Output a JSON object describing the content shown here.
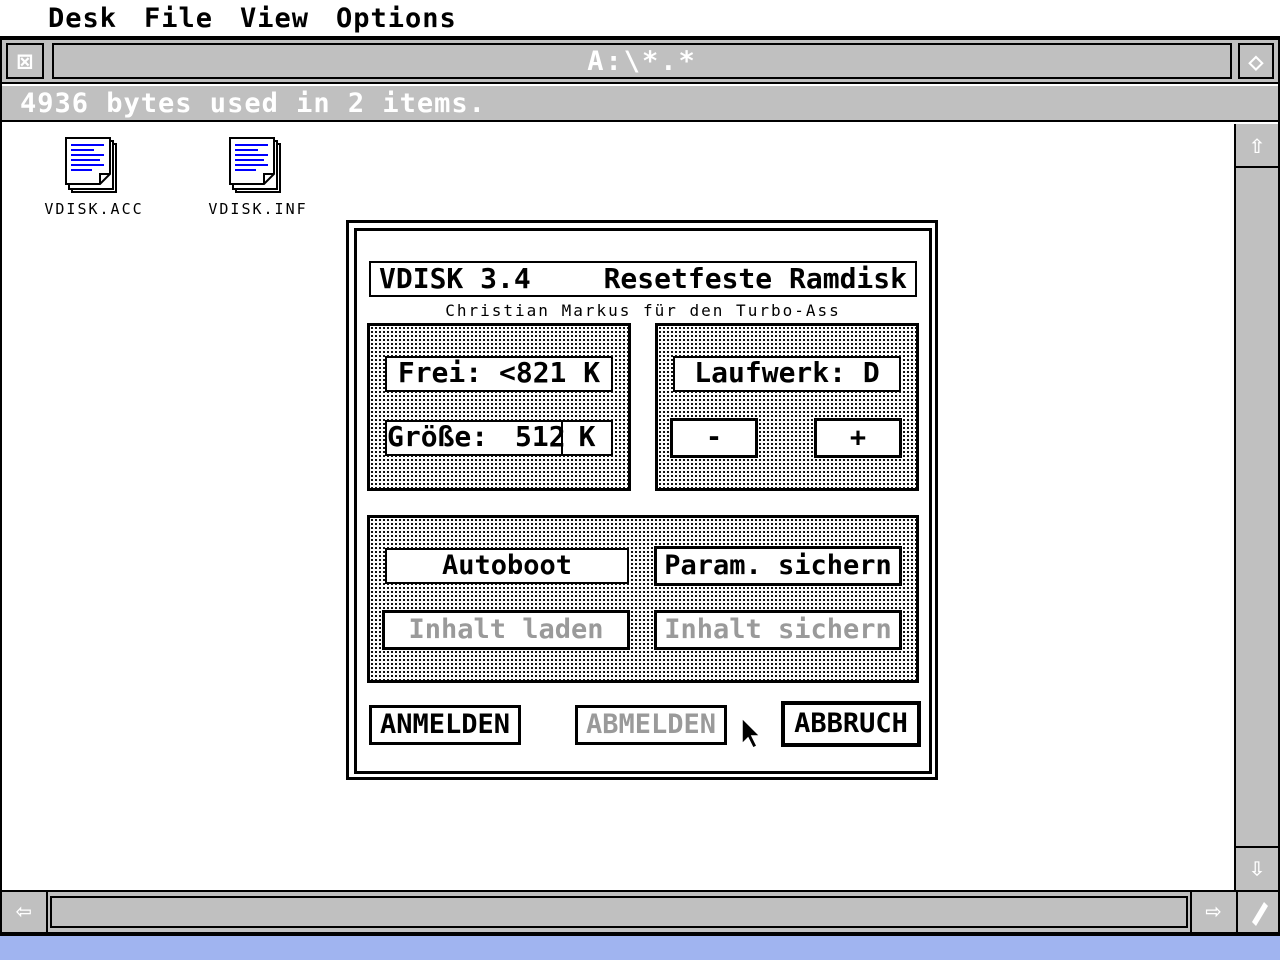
{
  "menubar": {
    "items": [
      "Desk",
      "File",
      "View",
      "Options"
    ]
  },
  "window": {
    "title": "A:\\*.*",
    "info": "4936 bytes used in 2 items.",
    "close_glyph": "⊠",
    "full_glyph": "◇",
    "up_glyph": "⇧",
    "down_glyph": "⇩",
    "left_glyph": "⇦",
    "right_glyph": "⇨",
    "files": [
      {
        "name": "VDISK.ACC",
        "icon": "document-icon"
      },
      {
        "name": "VDISK.INF",
        "icon": "document-icon"
      }
    ]
  },
  "dialog": {
    "title_left": "VDISK 3.4",
    "title_right": "Resetfeste Ramdisk",
    "subtitle": "Christian Markus für den Turbo-Ass",
    "frei": "Frei: <821 K",
    "groesse_label": "Größe:",
    "groesse_value": "512",
    "groesse_unit": "K",
    "laufwerk": "Laufwerk: D",
    "minus": "-",
    "plus": "+",
    "autoboot": "Autoboot",
    "param_sichern": "Param. sichern",
    "inhalt_laden": "Inhalt laden",
    "inhalt_sichern": "Inhalt sichern",
    "anmelden": "ANMELDEN",
    "abmelden": "ABMELDEN",
    "abbruch": "ABBRUCH"
  },
  "colors": {
    "gray": "#c0c0c0",
    "icon_blue": "#0000ff",
    "taskbar": "#a0b4f0"
  }
}
